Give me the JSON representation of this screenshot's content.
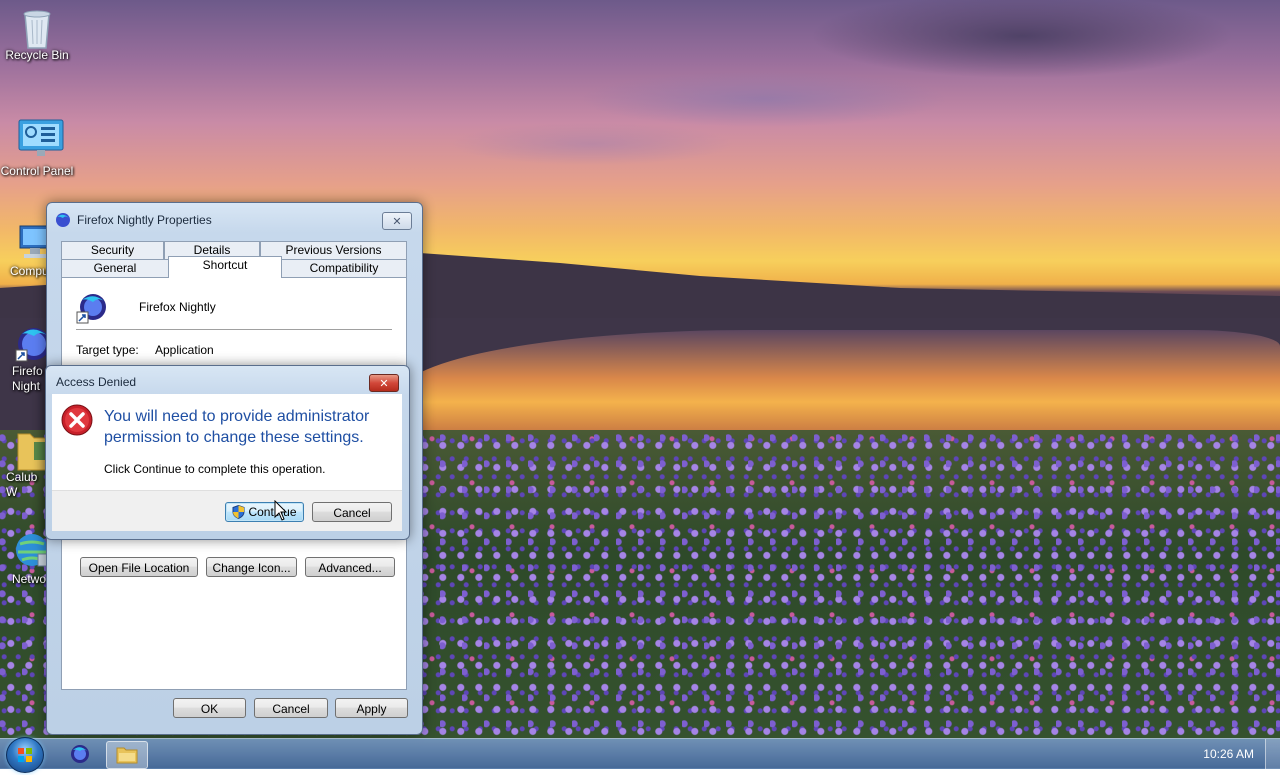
{
  "desktop": {
    "icons": [
      {
        "label": "Recycle Bin",
        "icon": "recycle-bin-icon"
      },
      {
        "label": "Control Panel",
        "icon": "control-panel-icon"
      },
      {
        "label": "Compu",
        "icon": "computer-icon"
      },
      {
        "label": "Firefo Night",
        "icon": "firefox-nightly-icon"
      },
      {
        "label": "Calub W",
        "icon": "folder-icon"
      },
      {
        "label": "Netwo",
        "icon": "network-icon"
      }
    ]
  },
  "properties_window": {
    "title": "Firefox Nightly Properties",
    "tabs_row1": [
      "Security",
      "Details",
      "Previous Versions"
    ],
    "tabs_row2": [
      "General",
      "Shortcut",
      "Compatibility"
    ],
    "active_tab": "Shortcut",
    "app_name": "Firefox Nightly",
    "target_type_label": "Target type:",
    "target_type_value": "Application",
    "buttons": {
      "open_file_location": "Open File Location",
      "change_icon": "Change Icon...",
      "advanced": "Advanced...",
      "ok": "OK",
      "cancel": "Cancel",
      "apply": "Apply"
    }
  },
  "access_denied_dialog": {
    "title": "Access Denied",
    "message": "You will need to provide administrator permission to change these settings.",
    "instruction": "Click Continue to complete this operation.",
    "continue_label": "Continue",
    "cancel_label": "Cancel"
  },
  "taskbar": {
    "clock": "10:26 AM"
  },
  "colors": {
    "dialog_heading": "#1f4fa3",
    "error_red": "#c8202a"
  }
}
